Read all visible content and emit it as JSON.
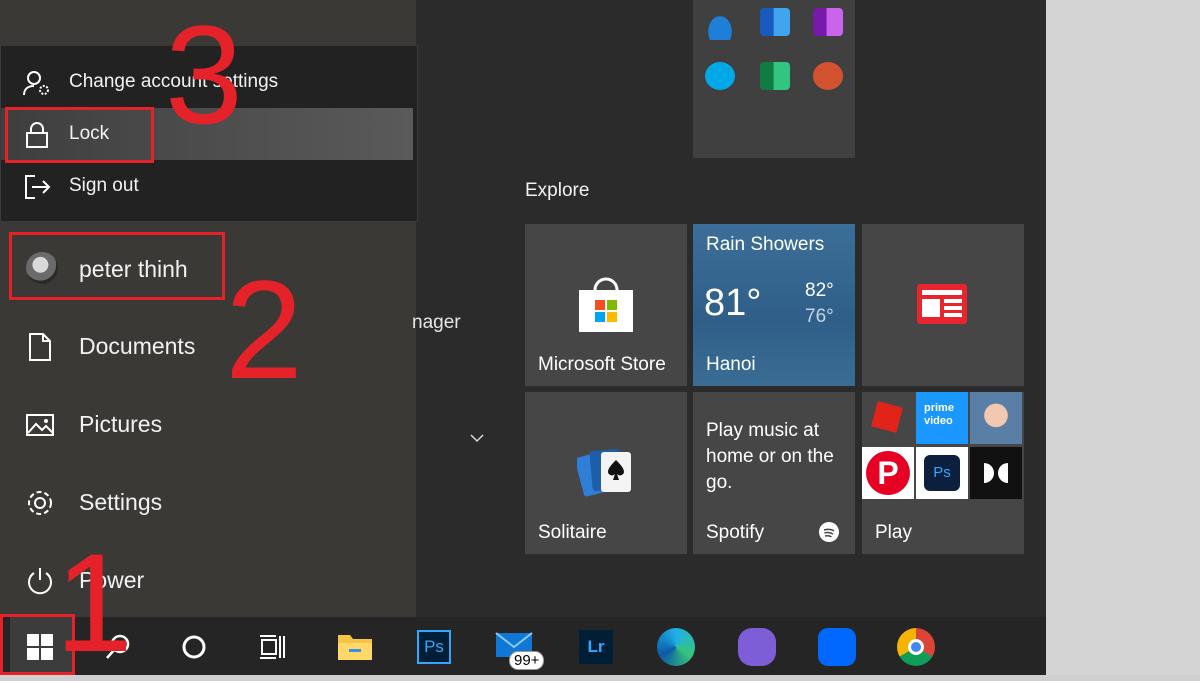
{
  "popup": {
    "change_settings": "Change account settings",
    "lock": "Lock",
    "sign_out": "Sign out"
  },
  "left": {
    "user_name": "peter thinh",
    "documents": "Documents",
    "pictures": "Pictures",
    "settings": "Settings",
    "power": "Power",
    "partial_label": "nager"
  },
  "explore": {
    "title": "Explore"
  },
  "tiles": {
    "store": "Microsoft Store",
    "weather": {
      "title": "Rain Showers",
      "temp": "81°",
      "high": "82°",
      "low": "76°",
      "city": "Hanoi"
    },
    "solitaire": "Solitaire",
    "spotify": {
      "text": "Play music at home or on the go.",
      "label": "Spotify"
    },
    "play": "Play"
  },
  "taskbar": {
    "mail_badge": "99+"
  },
  "annotations": {
    "step1": "1",
    "step2": "2",
    "step3": "3"
  },
  "colors": {
    "annotation": "#e52229",
    "accent_blue": "#2f5f88"
  }
}
